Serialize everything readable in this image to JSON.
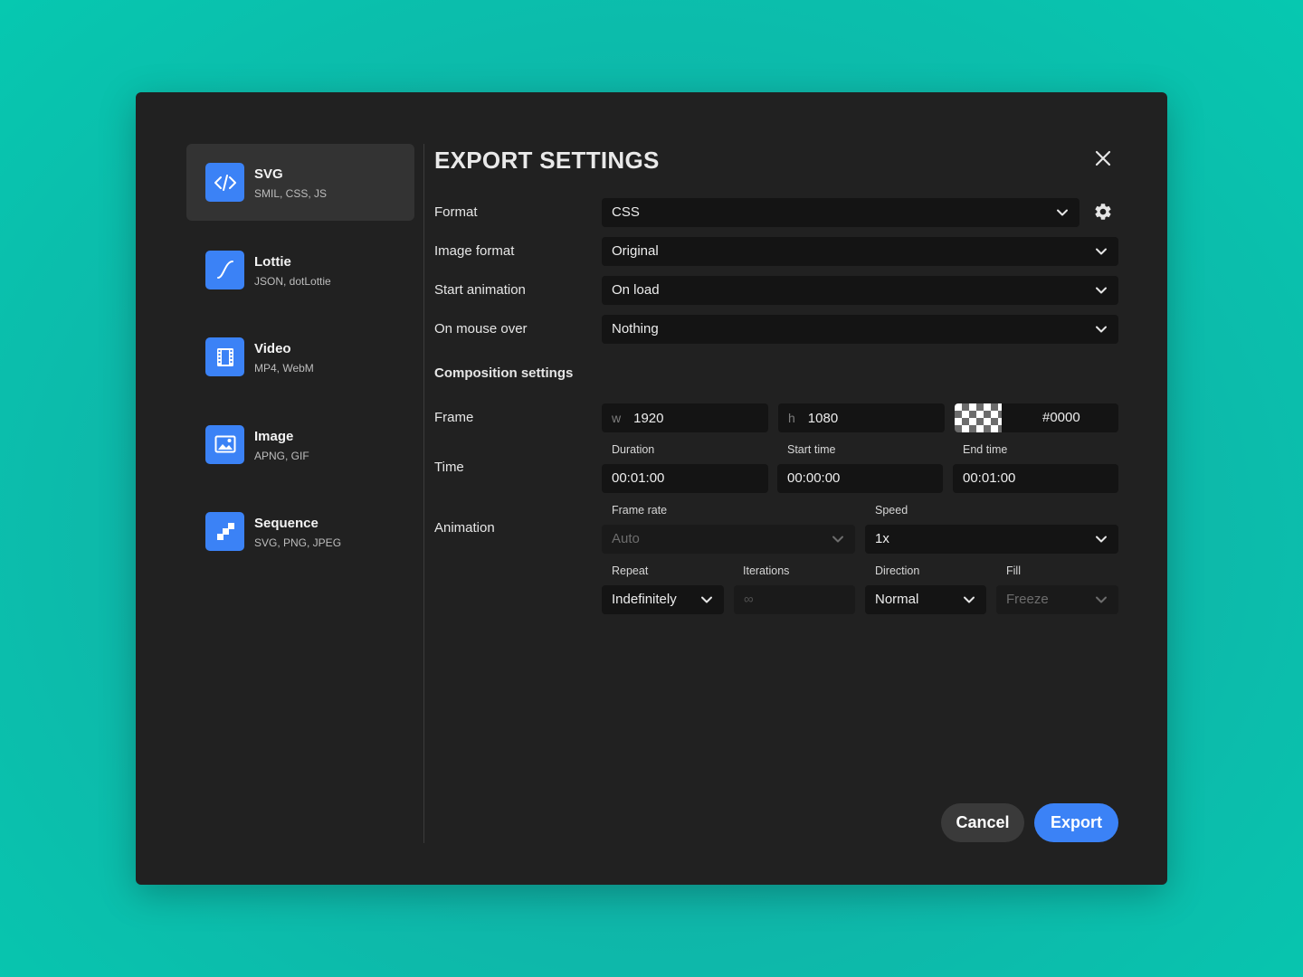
{
  "sidebar": {
    "items": [
      {
        "title": "SVG",
        "subtitle": "SMIL, CSS, JS",
        "icon": "code-icon"
      },
      {
        "title": "Lottie",
        "subtitle": "JSON, dotLottie",
        "icon": "curve-icon"
      },
      {
        "title": "Video",
        "subtitle": "MP4, WebM",
        "icon": "film-icon"
      },
      {
        "title": "Image",
        "subtitle": "APNG, GIF",
        "icon": "image-icon"
      },
      {
        "title": "Sequence",
        "subtitle": "SVG, PNG, JPEG",
        "icon": "sequence-icon"
      }
    ],
    "active": "SVG"
  },
  "header": {
    "title": "EXPORT SETTINGS"
  },
  "settings": {
    "format": {
      "label": "Format",
      "value": "CSS"
    },
    "image_format": {
      "label": "Image format",
      "value": "Original"
    },
    "start_animation": {
      "label": "Start animation",
      "value": "On load"
    },
    "mouse_over": {
      "label": "On mouse over",
      "value": "Nothing"
    }
  },
  "composition": {
    "heading": "Composition settings",
    "frame": {
      "label": "Frame",
      "w_prefix": "w",
      "width": "1920",
      "h_prefix": "h",
      "height": "1080",
      "background": "#0000"
    },
    "time": {
      "label": "Time",
      "duration_label": "Duration",
      "duration": "00:01:00",
      "start_label": "Start time",
      "start": "00:00:00",
      "end_label": "End time",
      "end": "00:01:00"
    },
    "animation": {
      "label": "Animation",
      "frame_rate_label": "Frame rate",
      "frame_rate": "Auto",
      "speed_label": "Speed",
      "speed": "1x",
      "repeat_label": "Repeat",
      "repeat": "Indefinitely",
      "iterations_label": "Iterations",
      "iterations_placeholder": "∞",
      "direction_label": "Direction",
      "direction": "Normal",
      "fill_label": "Fill",
      "fill": "Freeze"
    }
  },
  "footer": {
    "cancel": "Cancel",
    "export": "Export"
  },
  "colors": {
    "accent": "#3b82f6",
    "dialog_bg": "#212121",
    "field_bg": "#141414"
  }
}
